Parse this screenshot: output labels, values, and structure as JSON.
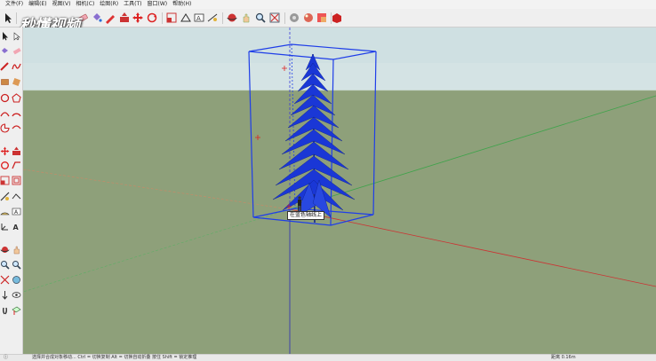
{
  "menu": [
    "文件(F)",
    "编辑(E)",
    "视图(V)",
    "相机(C)",
    "绘图(R)",
    "工具(T)",
    "窗口(W)",
    "帮助(H)"
  ],
  "watermark": {
    "logo_text": "秒懂视频"
  },
  "viewport": {
    "tooltip": "在蓝色轴线上"
  },
  "status": {
    "left_text": "选择并合成对象移动...  Ctrl = 切换复制   Alt = 切换自动折叠   按住 Shift = 锁定推理",
    "right_text": "距离 0.16m"
  },
  "colors": {
    "sky": "#cfe0e2",
    "ground": "#8ea07a",
    "selection": "#1f3ee8",
    "tree": "#1a37d6"
  },
  "icons": {
    "toolbar": [
      "select-arrow-icon",
      "make-component-icon",
      "eraser-icon",
      "paint-bucket-icon",
      "pencil-line-icon",
      "arc-icon",
      "rectangle-icon",
      "circle-icon",
      "push-pull-icon",
      "offset-icon",
      "move-icon",
      "rotate-icon",
      "scale-icon",
      "follow-me-icon",
      "tape-measure-icon",
      "text-icon",
      "axes-icon",
      "dimension-icon",
      "protractor-icon",
      "section-plane-icon",
      "orbit-icon",
      "pan-icon",
      "zoom-icon",
      "zoom-extents-icon",
      "geo-location-icon",
      "components-icon",
      "materials-icon",
      "warehouse-icon"
    ]
  }
}
